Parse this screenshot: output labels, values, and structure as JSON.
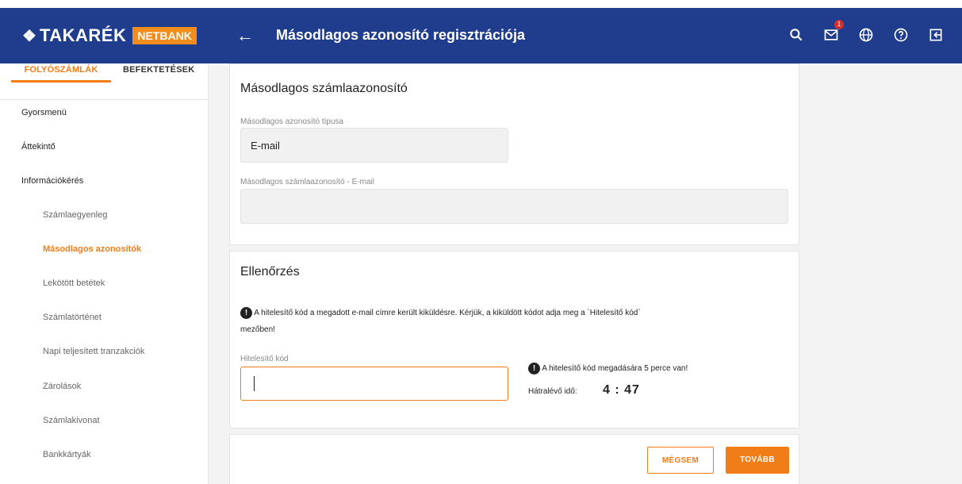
{
  "header": {
    "logo_mark": "❖",
    "logo_text": "TAKARÉK",
    "logo_badge": "NETBANK",
    "back_icon": "arrow-left-icon",
    "title": "Másodlagos azonosító regisztrációja",
    "icons": [
      "search-icon",
      "mail-icon",
      "globe-icon",
      "help-icon",
      "logout-icon"
    ],
    "mail_badge": "1",
    "color": "#1f3d8c"
  },
  "sidebar": {
    "tabs": [
      "FOLYÓSZÁMLÁK",
      "BEFEKTETÉSEK"
    ],
    "items": [
      {
        "label": "Gyorsmenü"
      },
      {
        "label": "Áttekintő"
      },
      {
        "label": "Információkérés"
      },
      {
        "label": "Számlaegyenleg"
      },
      {
        "label": "Másodlagos azonosítók"
      },
      {
        "label": "Lekötött betétek"
      },
      {
        "label": "Számlatörténet"
      },
      {
        "label": "Napi teljesített tranzakciók"
      },
      {
        "label": "Zárolások"
      },
      {
        "label": "Számlakivonat"
      },
      {
        "label": "Bankkártyák"
      }
    ],
    "accent": "#f07d17"
  },
  "identifier_card": {
    "title": "Másodlagos számlaazonosító",
    "type_label": "Másodlagos azonosító típusa",
    "type_value": "E-mail",
    "email_label": "Másodlagos számlaazonosító - E-mail",
    "email_value": ""
  },
  "verification_card": {
    "title": "Ellenőrzés",
    "info_line1": "A hitelesítő kód a megadott e-mail címre került kiküldésre. Kérjük, a kiküldött kódot adja meg a `Hitelesítő kód`",
    "info_line2": "mezőben!",
    "code_label": "Hitelesítő kód",
    "code_value": "",
    "timer_note": "A hitelesítő kód megadására 5 perce van!",
    "remaining_label": "Hátralévő idő:",
    "remaining_value": "4 : 47"
  },
  "actions": {
    "cancel_label": "MÉGSEM",
    "next_label": "TOVÁBB"
  }
}
